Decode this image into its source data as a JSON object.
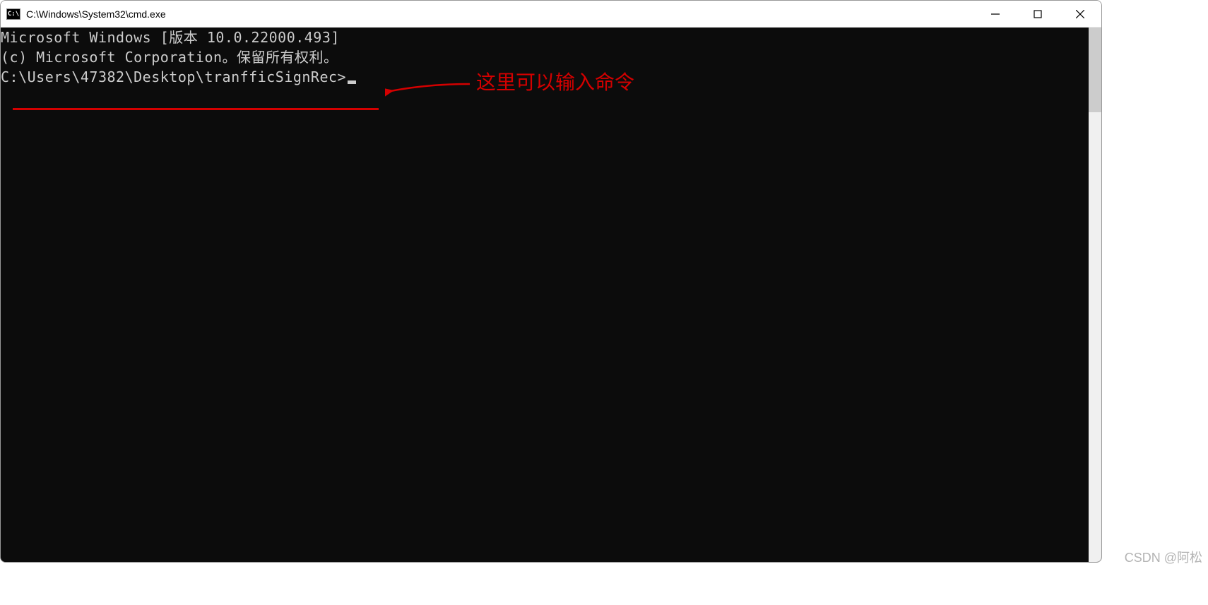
{
  "window": {
    "title": "C:\\Windows\\System32\\cmd.exe",
    "icon_label": "C:\\"
  },
  "terminal": {
    "line1": "Microsoft Windows [版本 10.0.22000.493]",
    "line2": "(c) Microsoft Corporation。保留所有权利。",
    "line3_blank": "",
    "prompt": "C:\\Users\\47382\\Desktop\\tranfficSignRec>"
  },
  "annotation": {
    "label": "这里可以输入命令"
  },
  "watermark": "CSDN @阿松"
}
